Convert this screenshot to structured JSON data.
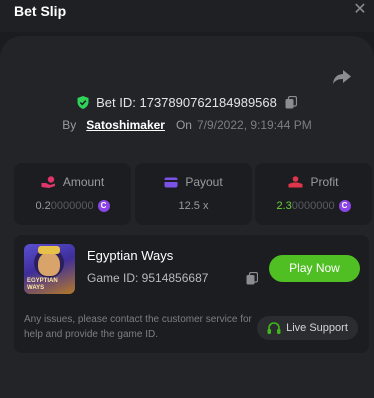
{
  "header": {
    "title": "Bet Slip",
    "close_glyph": "✕"
  },
  "bet": {
    "id_text": "Bet ID: 1737890762184989568",
    "by_label": "By",
    "user": "Satoshimaker",
    "on_label": "On",
    "date": "7/9/2022, 9:19:44 PM"
  },
  "stats": {
    "amount": {
      "label": "Amount",
      "value_main": "0.2",
      "value_dim": "0000000",
      "coin": "C"
    },
    "payout": {
      "label": "Payout",
      "value": "12.5 x"
    },
    "profit": {
      "label": "Profit",
      "value_main": "2.3",
      "value_dim": "0000000",
      "coin": "C"
    }
  },
  "game": {
    "thumb_text": "EGYPTIAN WAYS",
    "name": "Egyptian Ways",
    "id_text": "Game ID: 9514856687",
    "play_label": "Play Now",
    "help_text": "Any issues, please contact the customer service for help and provide the game ID.",
    "support_label": "Live Support"
  },
  "colors": {
    "accent_green": "#4fbf24",
    "coin_purple": "#8b45e6",
    "shield_green": "#2fd35a",
    "amount_pink": "#e0356b",
    "payout_purple": "#7b52e8",
    "profit_red": "#e0354a"
  },
  "icons": {
    "close": "close-icon",
    "share": "share-icon",
    "shield": "shield-check-icon",
    "copy": "copy-icon",
    "amount": "hand-coin-icon",
    "payout": "card-icon",
    "profit": "profit-icon",
    "coin": "coin-icon",
    "support": "headset-icon"
  }
}
